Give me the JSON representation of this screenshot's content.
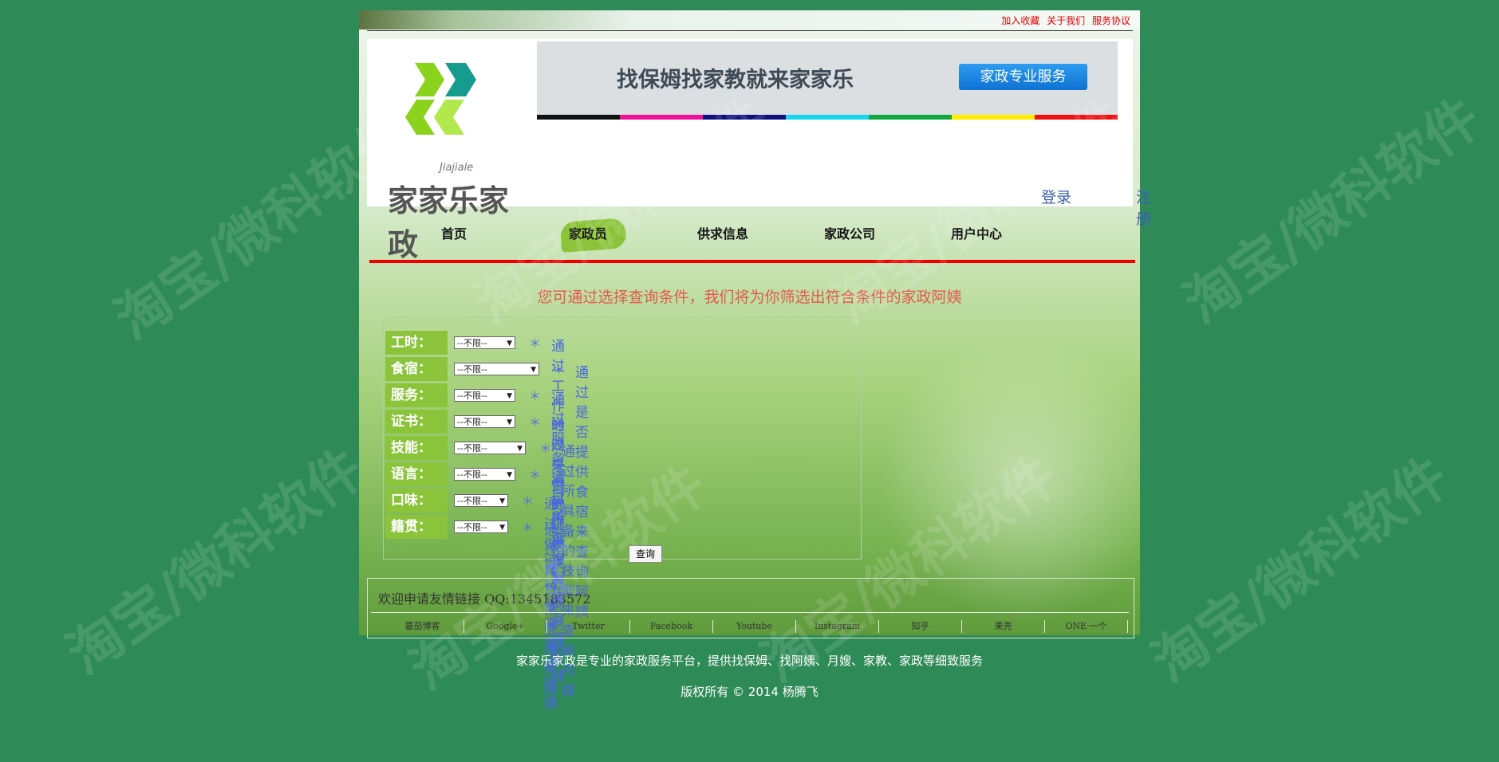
{
  "toplinks": [
    "加入收藏",
    "关于我们",
    "服务协议"
  ],
  "logo": {
    "brand": "家家乐家政",
    "sub": "Jiajiale"
  },
  "banner": {
    "title": "找保姆找家教就来家家乐",
    "button": "家政专业服务",
    "stripe_colors": [
      "#111111",
      "#ee1199",
      "#101080",
      "#18d4ee",
      "#10aa40",
      "#ffee00",
      "#ee1111"
    ]
  },
  "auth": {
    "login": "登录",
    "register": "注册"
  },
  "nav": [
    "首页",
    "家政员",
    "供求信息",
    "家政公司",
    "用户中心"
  ],
  "hint": "您可通过选择查询条件，我们将为你筛选出符合条件的家政阿姨",
  "filters": [
    {
      "label": "工时：",
      "value": "--不限--",
      "desc": "通过工作时间来查询阿姨"
    },
    {
      "label": "食宿：",
      "value": "--不限--",
      "desc": "通过是否提供食宿来查询阿姨"
    },
    {
      "label": "服务：",
      "value": "--不限--",
      "desc": "通过服务项目来查询阿姨"
    },
    {
      "label": "证书：",
      "value": "--不限--",
      "desc": "通过提供的证书来查询阿姨"
    },
    {
      "label": "技能：",
      "value": "--不限--",
      "desc": "通过所具备的技能来查询阿姨"
    },
    {
      "label": "语言：",
      "value": "--不限--",
      "desc": "通过所说语言来查询阿姨"
    },
    {
      "label": "口味：",
      "value": "--不限--",
      "desc": "通过做饭口味来查询阿姨"
    },
    {
      "label": "籍贯：",
      "value": "--不限--",
      "desc": "通过籍贯来查询阿姨"
    }
  ],
  "star": "＊",
  "query_button": "查询",
  "friend": {
    "title": "欢迎申请友情链接 QQ:1345183572",
    "links": [
      "蕃茄博客",
      "Google+",
      "Twitter",
      "Facebook",
      "Youtube",
      "Instagram",
      "知乎",
      "果壳",
      "ONE·一个"
    ]
  },
  "footer": {
    "line1": "家家乐家政是专业的家政服务平台，提供找保姆、找阿姨、月嫂、家教、家政等细致服务",
    "line2": "版权所有 © 2014 杨腾飞"
  },
  "watermark": "淘宝/微科软件"
}
